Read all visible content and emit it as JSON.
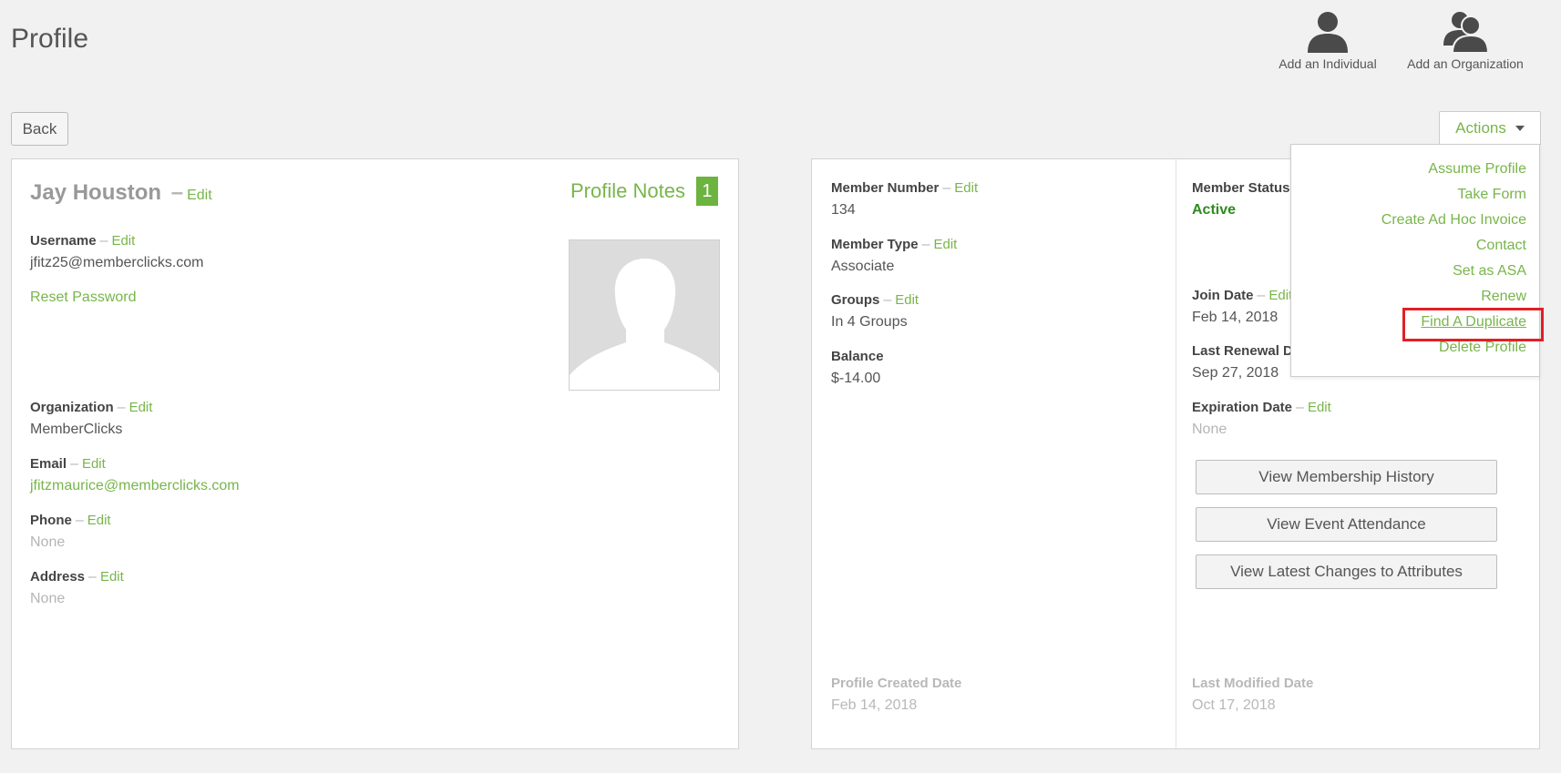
{
  "page": {
    "title": "Profile"
  },
  "quick_add": {
    "individual": "Add an Individual",
    "organization": "Add an Organization"
  },
  "toolbar": {
    "back": "Back",
    "actions": "Actions"
  },
  "actions_menu": [
    "Assume Profile",
    "Take Form",
    "Create Ad Hoc Invoice",
    "Contact",
    "Set as ASA",
    "Renew",
    "Find A Duplicate",
    "Delete Profile"
  ],
  "edit_label": "Edit",
  "dash": "–",
  "left": {
    "name": "Jay Houston",
    "profile_notes_label": "Profile Notes",
    "profile_notes_count": "1",
    "username_label": "Username",
    "username": "jfitz25@memberclicks.com",
    "reset_password": "Reset Password",
    "organization_label": "Organization",
    "organization": "MemberClicks",
    "email_label": "Email",
    "email": "jfitzmaurice@memberclicks.com",
    "phone_label": "Phone",
    "phone": "None",
    "address_label": "Address",
    "address": "None"
  },
  "right": {
    "member_number_label": "Member Number",
    "member_number": "134",
    "member_type_label": "Member Type",
    "member_type": "Associate",
    "groups_label": "Groups",
    "groups": "In 4 Groups",
    "balance_label": "Balance",
    "balance": "$-14.00",
    "member_status_label": "Member Status",
    "member_status": "Active",
    "join_date_label": "Join Date",
    "join_date": "Feb 14, 2018",
    "last_renewal_label": "Last Renewal Date",
    "last_renewal": "Sep 27, 2018",
    "expiration_label": "Expiration Date",
    "expiration": "None",
    "btn_history": "View Membership History",
    "btn_attendance": "View Event Attendance",
    "btn_changes": "View Latest Changes to Attributes",
    "created_label": "Profile Created Date",
    "created": "Feb 14, 2018",
    "modified_label": "Last Modified Date",
    "modified": "Oct 17, 2018"
  },
  "colors": {
    "accent": "#78b54a",
    "badge": "#6cb33f",
    "active": "#2e8b1e",
    "highlight": "#e21f26"
  }
}
